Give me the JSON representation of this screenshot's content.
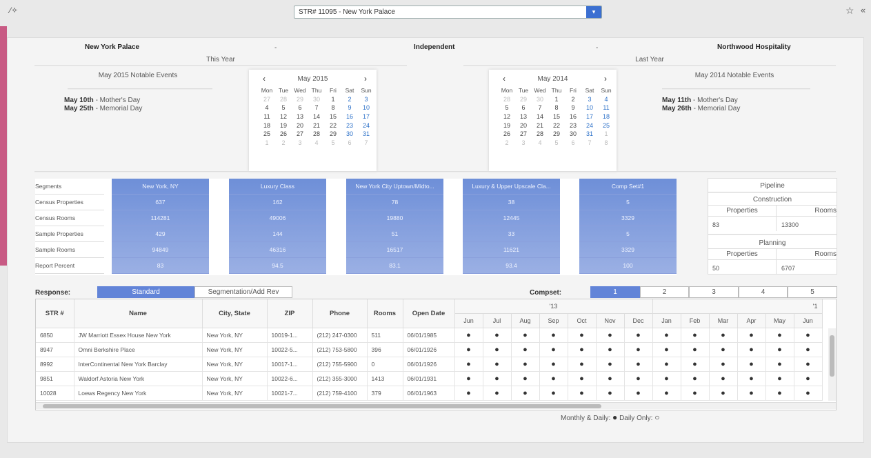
{
  "toolbar": {
    "property_select": "STR# 11095 - New York Palace",
    "wand_icon": "magic-wand-icon",
    "star_icon": "star-icon",
    "collapse_icon": "double-chevron-left-icon"
  },
  "header": {
    "property": "New York Palace",
    "affiliation": "Independent",
    "management": "Northwood Hospitality",
    "dash1": "-",
    "dash2": "-"
  },
  "this_year": {
    "label": "This Year",
    "events_title": "May 2015 Notable Events",
    "events": [
      {
        "date": "May 10th",
        "name": " - Mother's Day"
      },
      {
        "date": "May 25th",
        "name": " - Memorial Day"
      }
    ],
    "calendar": {
      "month": "May 2015",
      "weekdays": [
        "Mon",
        "Tue",
        "Wed",
        "Thu",
        "Fri",
        "Sat",
        "Sun"
      ],
      "weeks": [
        [
          "27",
          "28",
          "29",
          "30",
          "1",
          "2",
          "3"
        ],
        [
          "4",
          "5",
          "6",
          "7",
          "8",
          "9",
          "10"
        ],
        [
          "11",
          "12",
          "13",
          "14",
          "15",
          "16",
          "17"
        ],
        [
          "18",
          "19",
          "20",
          "21",
          "22",
          "23",
          "24"
        ],
        [
          "25",
          "26",
          "27",
          "28",
          "29",
          "30",
          "31"
        ],
        [
          "1",
          "2",
          "3",
          "4",
          "5",
          "6",
          "7"
        ]
      ]
    }
  },
  "last_year": {
    "label": "Last Year",
    "events_title": "May 2014 Notable Events",
    "events": [
      {
        "date": "May 11th",
        "name": " - Mother's Day"
      },
      {
        "date": "May 26th",
        "name": " - Memorial Day"
      }
    ],
    "calendar": {
      "month": "May 2014",
      "weekdays": [
        "Mon",
        "Tue",
        "Wed",
        "Thu",
        "Fri",
        "Sat",
        "Sun"
      ],
      "weeks": [
        [
          "28",
          "29",
          "30",
          "1",
          "2",
          "3",
          "4"
        ],
        [
          "5",
          "6",
          "7",
          "8",
          "9",
          "10",
          "11"
        ],
        [
          "12",
          "13",
          "14",
          "15",
          "16",
          "17",
          "18"
        ],
        [
          "19",
          "20",
          "21",
          "22",
          "23",
          "24",
          "25"
        ],
        [
          "26",
          "27",
          "28",
          "29",
          "30",
          "31",
          "1"
        ],
        [
          "2",
          "3",
          "4",
          "5",
          "6",
          "7",
          "8"
        ]
      ]
    }
  },
  "segments": {
    "row_labels": [
      "Segments",
      "Census Properties",
      "Census Rooms",
      "Sample Properties",
      "Sample Rooms",
      "Report Percent"
    ],
    "columns": [
      {
        "name": "New York, NY",
        "values": [
          "637",
          "114281",
          "429",
          "94849",
          "83"
        ]
      },
      {
        "name": "Luxury Class",
        "values": [
          "162",
          "49006",
          "144",
          "46316",
          "94.5"
        ]
      },
      {
        "name": "New York City Uptown/Midto...",
        "values": [
          "78",
          "19880",
          "51",
          "16517",
          "83.1"
        ]
      },
      {
        "name": "Luxury & Upper Upscale Cla...",
        "values": [
          "38",
          "12445",
          "33",
          "11621",
          "93.4"
        ]
      },
      {
        "name": "Comp Set#1",
        "values": [
          "5",
          "3329",
          "5",
          "3329",
          "100"
        ]
      }
    ]
  },
  "pipeline": {
    "title": "Pipeline",
    "construction": {
      "label": "Construction",
      "properties_label": "Properties",
      "rooms_label": "Rooms",
      "properties": "83",
      "rooms": "13300"
    },
    "planning": {
      "label": "Planning",
      "properties_label": "Properties",
      "rooms_label": "Rooms",
      "properties": "50",
      "rooms": "6707"
    }
  },
  "response": {
    "label": "Response:",
    "tabs": [
      "Standard",
      "Segmentation/Add Rev"
    ],
    "active": "Standard"
  },
  "compset": {
    "label": "Compset:",
    "tabs": [
      "1",
      "2",
      "3",
      "4",
      "5"
    ],
    "active": "1"
  },
  "grid": {
    "columns": [
      "STR #",
      "Name",
      "City, State",
      "ZIP",
      "Phone",
      "Rooms",
      "Open Date"
    ],
    "year1": "'13",
    "year2": "'1",
    "months": [
      "Jun",
      "Jul",
      "Aug",
      "Sep",
      "Oct",
      "Nov",
      "Dec",
      "Jan",
      "Feb",
      "Mar",
      "Apr",
      "May",
      "Jun"
    ],
    "rows": [
      [
        "6850",
        "JW Marriott Essex House New York",
        "New York, NY",
        "10019-1...",
        "(212) 247-0300",
        "511",
        "06/01/1985"
      ],
      [
        "8947",
        "Omni Berkshire Place",
        "New York, NY",
        "10022-5...",
        "(212) 753-5800",
        "396",
        "06/01/1926"
      ],
      [
        "8992",
        "InterContinental New York Barclay",
        "New York, NY",
        "10017-1...",
        "(212) 755-5900",
        "0",
        "06/01/1926"
      ],
      [
        "9851",
        "Waldorf Astoria New York",
        "New York, NY",
        "10022-6...",
        "(212) 355-3000",
        "1413",
        "06/01/1931"
      ],
      [
        "10028",
        "Loews Regency New York",
        "New York, NY",
        "10021-7...",
        "(212) 759-4100",
        "379",
        "06/01/1963"
      ]
    ],
    "dot": "●"
  },
  "legend": {
    "monthly_daily": "Monthly & Daily:",
    "daily_only": "Daily Only:",
    "filled": "●",
    "hollow": "○"
  }
}
